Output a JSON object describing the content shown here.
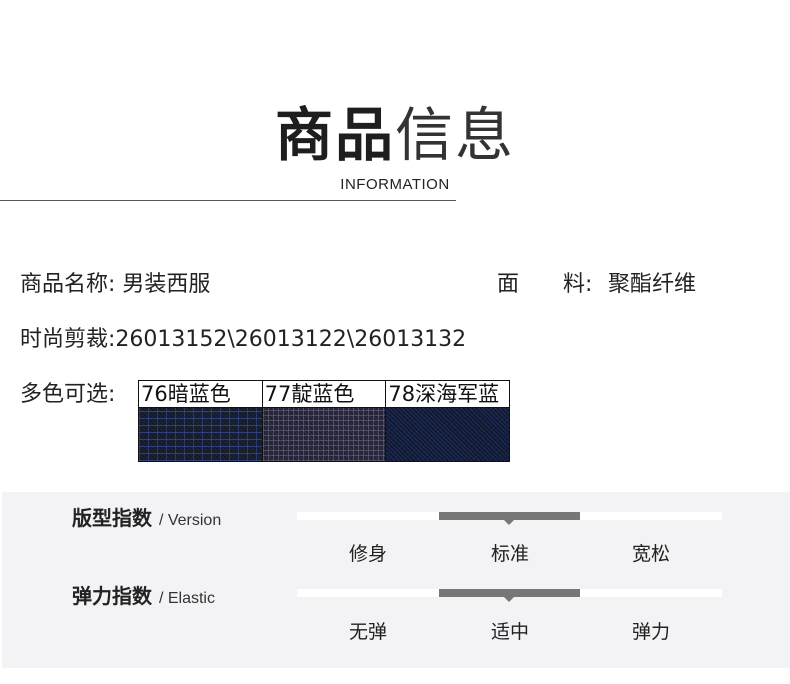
{
  "header": {
    "title_bold": "商品",
    "title_light": "信息",
    "subtitle": "INFORMATION"
  },
  "product": {
    "name_label": "商品名称:",
    "name_value": "男装西服",
    "material_label_a": "面",
    "material_label_b": "料:",
    "material_value": "聚酯纤维",
    "cut_label": "时尚剪裁:",
    "cut_value": "26013152\\26013122\\26013132",
    "colors_label": "多色可选:"
  },
  "colors": [
    {
      "label": "76暗蓝色",
      "swatch_color": "#1a2236"
    },
    {
      "label": "77靛蓝色",
      "swatch_color": "#2a2b3e"
    },
    {
      "label": "78深海军蓝",
      "swatch_color": "#131c36"
    }
  ],
  "indices": {
    "version": {
      "title": "版型指数",
      "title_en": "/ Version",
      "options": [
        "修身",
        "标准",
        "宽松"
      ],
      "selected_index": 1
    },
    "elastic": {
      "title": "弹力指数",
      "title_en": "/ Elastic",
      "options": [
        "无弹",
        "适中",
        "弹力"
      ],
      "selected_index": 1
    }
  },
  "theme": {
    "panel_bg": "#f3f3f5",
    "marker_color": "#777777",
    "track_color": "#ffffff"
  }
}
